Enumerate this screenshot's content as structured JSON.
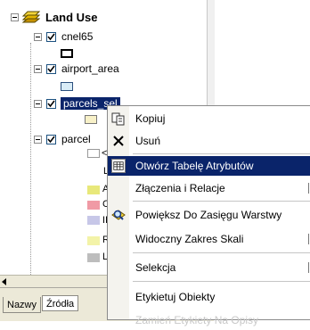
{
  "toc": {
    "group_name": "Land Use",
    "layers": [
      {
        "name": "cnel65"
      },
      {
        "name": "airport_area"
      },
      {
        "name": "parcels_sel"
      },
      {
        "name": "parcels"
      }
    ],
    "legend_fragments": [
      "<",
      "L",
      "A",
      "C",
      "II",
      "R",
      "L"
    ],
    "legend_colors": [
      "#e8e87a",
      "#f09aa5",
      "#c7c7e8",
      "#f3f3a8",
      "#bdbdbd"
    ]
  },
  "tabs": {
    "names_tab": "Nazwy",
    "source_tab": "Źródła"
  },
  "menu": {
    "items": [
      {
        "label": "Kopiuj",
        "icon": "copy-icon"
      },
      {
        "label": "Usuń",
        "icon": "delete-icon"
      },
      {
        "label": "Otwórz Tabelę Atrybutów",
        "icon": "table-icon",
        "highlighted": true
      },
      {
        "label": "Złączenia i Relacje",
        "submenu": true
      },
      {
        "label": "Powiększ Do Zasięgu Warstwy",
        "icon": "zoom-to-layer-icon"
      },
      {
        "label": "Widoczny Zakres Skali",
        "submenu": true
      },
      {
        "label": "Selekcja",
        "submenu": true
      },
      {
        "label": "Etykietuj Obiekty"
      },
      {
        "label": "Zamień Etykiety Na Opisy",
        "disabled": true
      }
    ]
  },
  "colors": {
    "selection": "#0a246a",
    "layer_group_icon": "#e8c000"
  }
}
